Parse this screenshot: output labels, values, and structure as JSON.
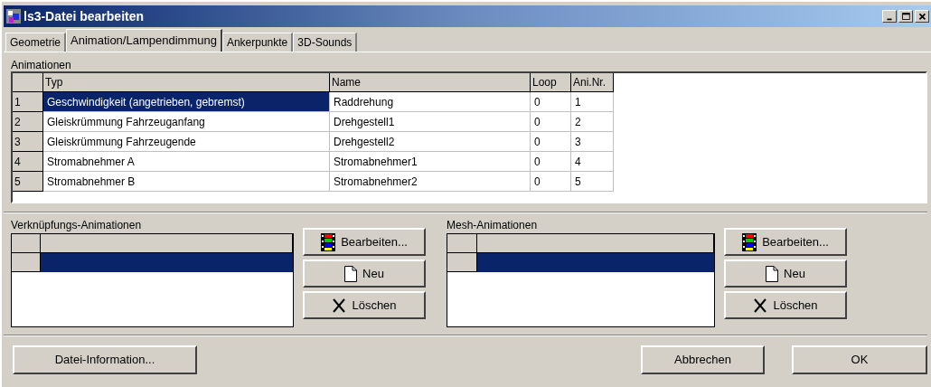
{
  "window": {
    "title": "ls3-Datei bearbeiten"
  },
  "tabs": [
    {
      "label": "Geometrie",
      "selected": false
    },
    {
      "label": "Animation/Lampendimmung",
      "selected": true
    },
    {
      "label": "Ankerpunkte",
      "selected": false
    },
    {
      "label": "3D-Sounds",
      "selected": false
    }
  ],
  "animations": {
    "label": "Animationen",
    "columns": [
      "Typ",
      "Name",
      "Loop",
      "Ani.Nr."
    ],
    "rows": [
      {
        "index": "1",
        "cells": [
          "Geschwindigkeit (angetrieben, gebremst)",
          "Raddrehung",
          "0",
          "1"
        ],
        "selected": true
      },
      {
        "index": "2",
        "cells": [
          "Gleiskrümmung Fahrzeuganfang",
          "Drehgestell1",
          "0",
          "2"
        ],
        "selected": false
      },
      {
        "index": "3",
        "cells": [
          "Gleiskrümmung Fahrzeugende",
          "Drehgestell2",
          "0",
          "3"
        ],
        "selected": false
      },
      {
        "index": "4",
        "cells": [
          "Stromabnehmer A",
          "Stromabnehmer1",
          "0",
          "4"
        ],
        "selected": false
      },
      {
        "index": "5",
        "cells": [
          "Stromabnehmer B",
          "Stromabnehmer2",
          "0",
          "5"
        ],
        "selected": false
      }
    ]
  },
  "panels": [
    {
      "label": "Verknüpfungs-Animationen",
      "rows": [
        {
          "selected": true
        }
      ],
      "buttons": [
        {
          "kind": "edit",
          "label": "Bearbeiten..."
        },
        {
          "kind": "new",
          "label": "Neu"
        },
        {
          "kind": "delete",
          "label": "Löschen"
        }
      ]
    },
    {
      "label": "Mesh-Animationen",
      "rows": [
        {
          "selected": true
        }
      ],
      "buttons": [
        {
          "kind": "edit",
          "label": "Bearbeiten..."
        },
        {
          "kind": "new",
          "label": "Neu"
        },
        {
          "kind": "delete",
          "label": "Löschen"
        }
      ]
    }
  ],
  "footer": {
    "info_button": "Datei-Information...",
    "cancel_button": "Abbrechen",
    "ok_button": "OK"
  }
}
